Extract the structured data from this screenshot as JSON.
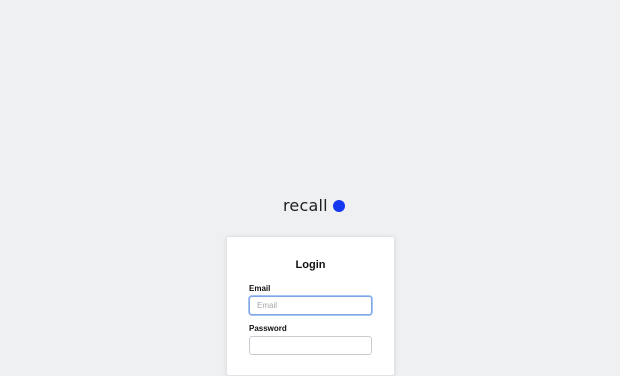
{
  "brand": {
    "name": "recall",
    "accent_color": "#1437f2"
  },
  "login": {
    "title": "Login",
    "email_label": "Email",
    "email_placeholder": "Email",
    "email_value": "",
    "password_label": "Password",
    "password_placeholder": "",
    "password_value": ""
  }
}
